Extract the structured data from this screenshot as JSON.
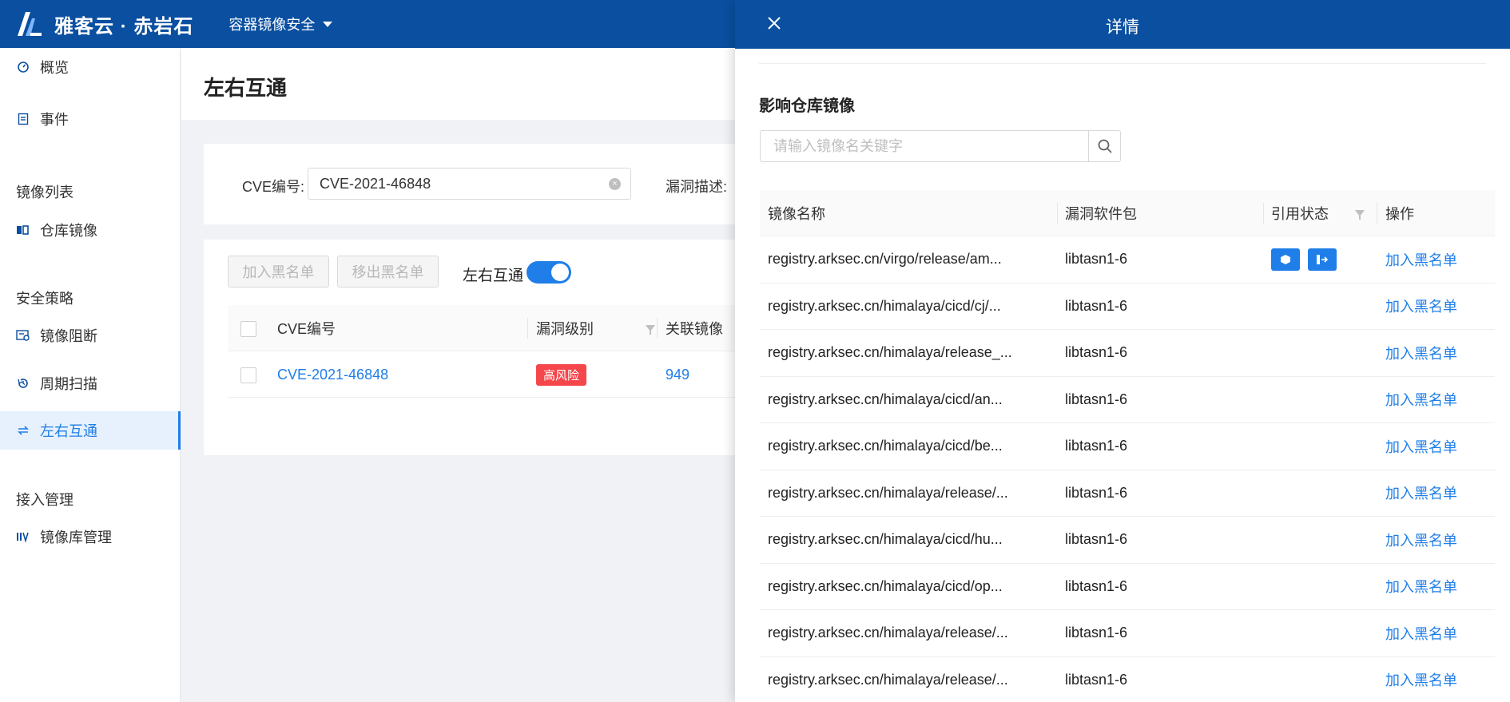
{
  "header": {
    "brand": "雅客云 · 赤岩石",
    "module": "容器镜像安全"
  },
  "sidebar": {
    "items": [
      {
        "label": "概览",
        "icon": "dashboard-icon"
      },
      {
        "label": "事件",
        "icon": "document-icon"
      },
      {
        "label": "仓库镜像",
        "icon": "repository-icon"
      },
      {
        "label": "镜像阻断",
        "icon": "block-icon"
      },
      {
        "label": "周期扫描",
        "icon": "history-icon"
      },
      {
        "label": "左右互通",
        "icon": "swap-icon",
        "active": true
      },
      {
        "label": "镜像库管理",
        "icon": "registry-icon"
      }
    ],
    "groups": [
      "镜像列表",
      "安全策略",
      "接入管理"
    ]
  },
  "page": {
    "title": "左右互通",
    "filters": {
      "cve_label": "CVE编号:",
      "cve_value": "CVE-2021-46848",
      "desc_label": "漏洞描述:"
    },
    "actions": {
      "add_blacklist": "加入黑名单",
      "remove_blacklist": "移出黑名单",
      "toggle_label": "左右互通",
      "toggle_on": true
    },
    "table": {
      "columns": [
        "CVE编号",
        "漏洞级别",
        "关联镜像"
      ],
      "rows": [
        {
          "cve": "CVE-2021-46848",
          "level": "高风险",
          "images": "949"
        }
      ]
    }
  },
  "drawer": {
    "title": "详情",
    "section_title": "影响仓库镜像",
    "search_placeholder": "请输入镜像名关键字",
    "columns": [
      "镜像名称",
      "漏洞软件包",
      "引用状态",
      "操作"
    ],
    "action_label": "加入黑名单",
    "rows": [
      {
        "name": "registry.arksec.cn/virgo/release/am...",
        "package": "libtasn1-6",
        "has_status": true
      },
      {
        "name": "registry.arksec.cn/himalaya/cicd/cj/...",
        "package": "libtasn1-6",
        "has_status": false
      },
      {
        "name": "registry.arksec.cn/himalaya/release_...",
        "package": "libtasn1-6",
        "has_status": false
      },
      {
        "name": "registry.arksec.cn/himalaya/cicd/an...",
        "package": "libtasn1-6",
        "has_status": false
      },
      {
        "name": "registry.arksec.cn/himalaya/cicd/be...",
        "package": "libtasn1-6",
        "has_status": false
      },
      {
        "name": "registry.arksec.cn/himalaya/release/...",
        "package": "libtasn1-6",
        "has_status": false
      },
      {
        "name": "registry.arksec.cn/himalaya/cicd/hu...",
        "package": "libtasn1-6",
        "has_status": false
      },
      {
        "name": "registry.arksec.cn/himalaya/cicd/op...",
        "package": "libtasn1-6",
        "has_status": false
      },
      {
        "name": "registry.arksec.cn/himalaya/release/...",
        "package": "libtasn1-6",
        "has_status": false
      },
      {
        "name": "registry.arksec.cn/himalaya/release/...",
        "package": "libtasn1-6",
        "has_status": false
      }
    ]
  },
  "colors": {
    "primary": "#0a4fa0",
    "accent": "#1f7ee8",
    "danger": "#f5474b"
  }
}
